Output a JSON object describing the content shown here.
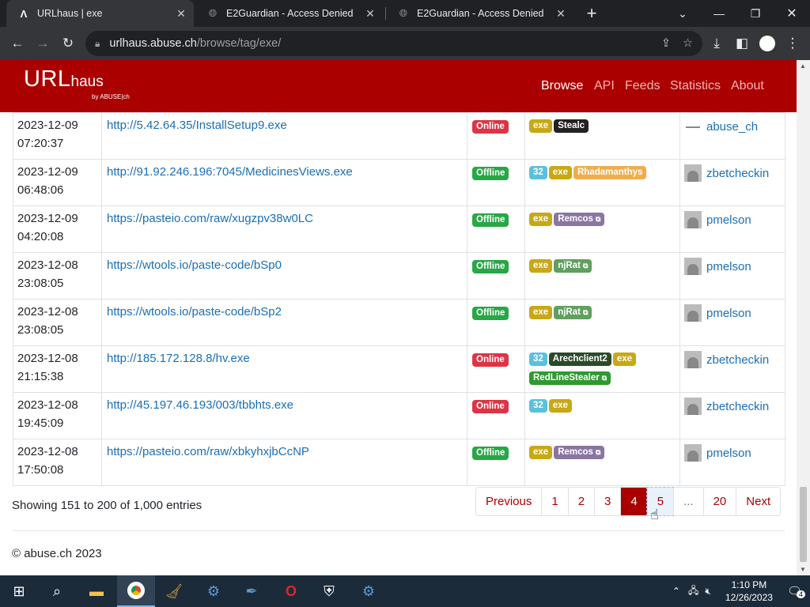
{
  "browser": {
    "tabs": [
      {
        "title": "URLhaus | exe",
        "active": true
      },
      {
        "title": "E2Guardian - Access Denied",
        "active": false
      },
      {
        "title": "E2Guardian - Access Denied",
        "active": false
      }
    ],
    "new_tab": "+",
    "url_host": "urlhaus.abuse.ch",
    "url_path": "/browse/tag/exe/"
  },
  "site": {
    "logo_main": "URL",
    "logo_sub": "haus",
    "logo_by": "by ABUSE|ch",
    "nav": [
      "Browse",
      "API",
      "Feeds",
      "Statistics",
      "About"
    ]
  },
  "rows": [
    {
      "date": "2023-12-09",
      "time": "07:20:37",
      "url": "http://5.42.64.35/InstallSetup9.exe",
      "status": "Online",
      "tags": [
        {
          "t": "exe",
          "c": "exe"
        },
        {
          "t": "Stealc",
          "c": "steal"
        }
      ],
      "reporter": "abuse_ch",
      "avatar": "abuse"
    },
    {
      "date": "2023-12-09",
      "time": "06:48:06",
      "url": "http://91.92.246.196:7045/MedicinesViews.exe",
      "status": "Offline",
      "tags": [
        {
          "t": "32",
          "c": "b32"
        },
        {
          "t": "exe",
          "c": "exe"
        },
        {
          "t": "Rhadamanthys",
          "c": "rhad"
        }
      ],
      "reporter": "zbetcheckin",
      "avatar": "user"
    },
    {
      "date": "2023-12-09",
      "time": "04:20:08",
      "url": "https://pasteio.com/raw/xugzpv38w0LC",
      "status": "Offline",
      "tags": [
        {
          "t": "exe",
          "c": "exe"
        },
        {
          "t": "Remcos",
          "c": "remc",
          "ext": true
        }
      ],
      "reporter": "pmelson",
      "avatar": "user"
    },
    {
      "date": "2023-12-08",
      "time": "23:08:05",
      "url": "https://wtools.io/paste-code/bSp0",
      "status": "Offline",
      "tags": [
        {
          "t": "exe",
          "c": "exe"
        },
        {
          "t": "njRat",
          "c": "njrat",
          "ext": true
        }
      ],
      "reporter": "pmelson",
      "avatar": "user"
    },
    {
      "date": "2023-12-08",
      "time": "23:08:05",
      "url": "https://wtools.io/paste-code/bSp2",
      "status": "Offline",
      "tags": [
        {
          "t": "exe",
          "c": "exe"
        },
        {
          "t": "njRat",
          "c": "njrat",
          "ext": true
        }
      ],
      "reporter": "pmelson",
      "avatar": "user"
    },
    {
      "date": "2023-12-08",
      "time": "21:15:38",
      "url": "http://185.172.128.8/hv.exe",
      "status": "Online",
      "tags": [
        {
          "t": "32",
          "c": "b32"
        },
        {
          "t": "Arechclient2",
          "c": "arch"
        },
        {
          "t": "exe",
          "c": "exe"
        },
        {
          "t": "RedLineStealer",
          "c": "rls",
          "ext": true
        }
      ],
      "reporter": "zbetcheckin",
      "avatar": "user"
    },
    {
      "date": "2023-12-08",
      "time": "19:45:09",
      "url": "http://45.197.46.193/003/tbbhts.exe",
      "status": "Online",
      "tags": [
        {
          "t": "32",
          "c": "b32"
        },
        {
          "t": "exe",
          "c": "exe"
        }
      ],
      "reporter": "zbetcheckin",
      "avatar": "user"
    },
    {
      "date": "2023-12-08",
      "time": "17:50:08",
      "url": "https://pasteio.com/raw/xbkyhxjbCcNP",
      "status": "Offline",
      "tags": [
        {
          "t": "exe",
          "c": "exe"
        },
        {
          "t": "Remcos",
          "c": "remc",
          "ext": true
        }
      ],
      "reporter": "pmelson",
      "avatar": "user"
    }
  ],
  "pagination": {
    "info": "Showing 151 to 200 of 1,000 entries",
    "previous": "Previous",
    "pages": [
      "1",
      "2",
      "3",
      "4",
      "5",
      "...",
      "20"
    ],
    "current": "4",
    "hover": "5",
    "next": "Next"
  },
  "footer": {
    "copyright": "© abuse.ch 2023"
  },
  "taskbar": {
    "time": "1:10 PM",
    "date": "12/26/2023",
    "notifications": "4"
  }
}
